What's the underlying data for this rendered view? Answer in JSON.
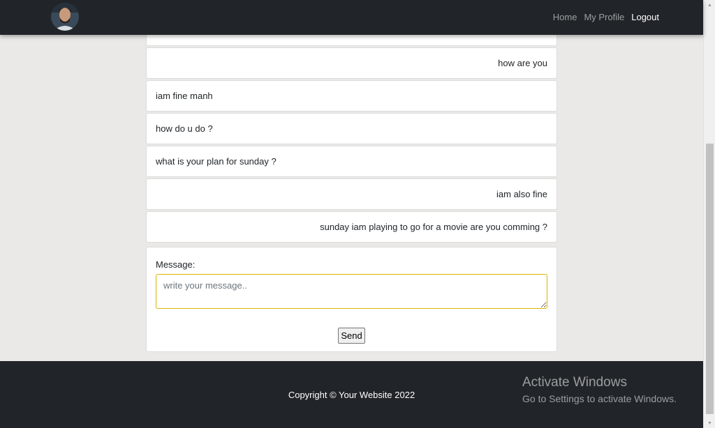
{
  "nav": {
    "links": [
      {
        "label": "Home",
        "active": false
      },
      {
        "label": "My Profile",
        "active": false
      },
      {
        "label": "Logout",
        "active": true
      }
    ]
  },
  "messages": [
    {
      "text": "",
      "side": "sent"
    },
    {
      "text": "how are you",
      "side": "sent"
    },
    {
      "text": "iam fine manh",
      "side": "received"
    },
    {
      "text": "how do u do ?",
      "side": "received"
    },
    {
      "text": "what is your plan for sunday ?",
      "side": "received"
    },
    {
      "text": "iam also fine",
      "side": "sent"
    },
    {
      "text": "sunday iam playing to go for a movie are you comming ?",
      "side": "sent"
    }
  ],
  "form": {
    "label": "Message:",
    "placeholder": "write your message..",
    "send_label": "Send"
  },
  "footer": {
    "copyright": "Copyright © Your Website 2022"
  },
  "watermark": {
    "title": "Activate Windows",
    "subtitle": "Go to Settings to activate Windows."
  },
  "colors": {
    "navbar_bg": "#212529",
    "page_bg": "#ebe9e7",
    "textarea_focus_border": "#d9b400"
  },
  "icons": {
    "avatar": "profile-avatar",
    "scroll_up": "up-arrow-icon",
    "scroll_down": "down-arrow-icon"
  }
}
